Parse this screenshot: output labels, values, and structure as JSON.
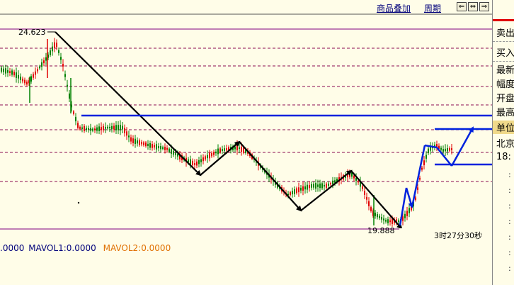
{
  "toolbar": {
    "overlay_label": "商品叠加",
    "period_label": "周期",
    "nav_buttons": [
      "⇐",
      "⇔",
      "⇒"
    ]
  },
  "chart": {
    "high_label": "24.623",
    "low_label": "19.888",
    "timer": "3时27分30秒"
  },
  "indicator": {
    "prefix": ".0000",
    "mavol1": "MAVOL1:0.0000",
    "mavol2": "MAVOL2:0.0000"
  },
  "sidepanel": {
    "rows": [
      "卖出",
      "买入",
      "最新",
      "幅度",
      "开盘",
      "最高",
      "单位",
      "北京",
      "18:"
    ]
  },
  "colors": {
    "background": "#fffde8",
    "candle_up": "#e00000",
    "candle_down": "#008000",
    "trend_black": "#000000",
    "trend_blue": "#0022dd",
    "grid_solid": "#800080",
    "grid_dashed": "#8b0a50",
    "mavol2": "#e07000"
  }
}
